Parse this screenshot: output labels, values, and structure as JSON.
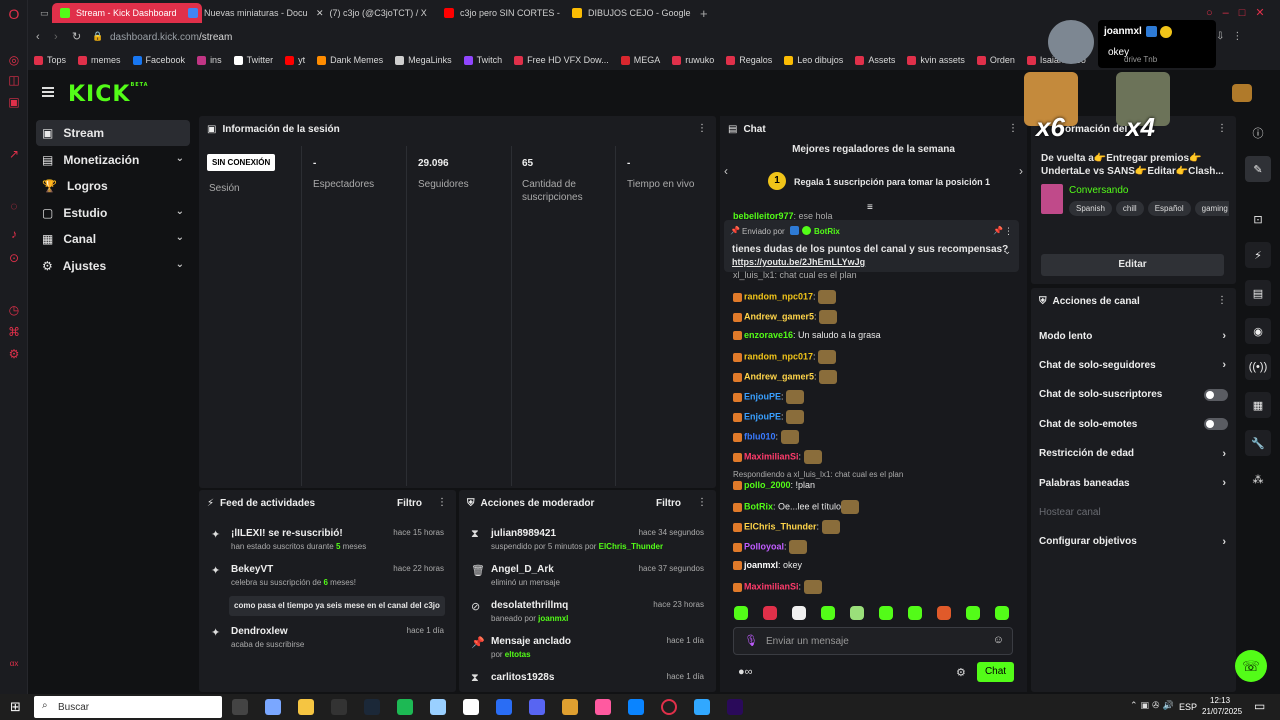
{
  "browser": {
    "tabs": [
      {
        "label": "Stream - Kick Dashboard",
        "color": "#53fc18",
        "active": true
      },
      {
        "label": "Nuevas miniaturas - Docu",
        "color": "#4285f4"
      },
      {
        "label": "(7) c3jo (@C3joTCT) / X",
        "color": "#ffffff"
      },
      {
        "label": "c3jo pero SIN CORTES -",
        "color": "#ff0000"
      },
      {
        "label": "DIBUJOS CEJO - Google D",
        "color": "#fbbc04"
      }
    ],
    "url": {
      "domain": "dashboard.kick.com",
      "path": "/stream"
    },
    "bookmarks": [
      {
        "label": "Tops",
        "color": "#e0304a"
      },
      {
        "label": "memes",
        "color": "#e0304a"
      },
      {
        "label": "Facebook",
        "color": "#1877f2"
      },
      {
        "label": "ins",
        "color": "#c13584"
      },
      {
        "label": "Twitter",
        "color": "#ffffff"
      },
      {
        "label": "yt",
        "color": "#ff0000"
      },
      {
        "label": "Dank Memes",
        "color": "#ff8c00"
      },
      {
        "label": "MegaLinks",
        "color": "#cfcfcf"
      },
      {
        "label": "Twitch",
        "color": "#9146ff"
      },
      {
        "label": "Free HD VFX Dow...",
        "color": "#e0304a"
      },
      {
        "label": "MEGA",
        "color": "#d9272e"
      },
      {
        "label": "ruwuko",
        "color": "#e0304a"
      },
      {
        "label": "Regalos",
        "color": "#e0304a"
      },
      {
        "label": "Leo dibujos",
        "color": "#fbbc04"
      },
      {
        "label": "Assets",
        "color": "#e0304a"
      },
      {
        "label": "kvin assets",
        "color": "#e0304a"
      },
      {
        "label": "Orden",
        "color": "#e0304a"
      },
      {
        "label": "Isaiah Creo",
        "color": "#e0304a"
      }
    ]
  },
  "overlay": {
    "user": "joanmxl",
    "message": "okey",
    "x6": "x6",
    "x4": "x4",
    "chip_text": "drive Tnb"
  },
  "kick": {
    "logo": "KICK",
    "logo_sup": "BETA"
  },
  "nav": [
    {
      "label": "Stream",
      "icon": "▣",
      "selected": true
    },
    {
      "label": "Monetización",
      "icon": "▤",
      "chevron": "⌄"
    },
    {
      "label": "Logros",
      "icon": "🏆"
    },
    {
      "label": "Estudio",
      "icon": "▢",
      "chevron": "⌄"
    },
    {
      "label": "Canal",
      "icon": "▦",
      "chevron": "⌄"
    },
    {
      "label": "Ajustes",
      "icon": "⚙",
      "chevron": "⌄"
    }
  ],
  "session": {
    "title": "Información de la sesión",
    "badge": "SIN CONEXIÓN",
    "stats": [
      {
        "value": "",
        "label": "Sesión"
      },
      {
        "value": "-",
        "label": "Espectadores"
      },
      {
        "value": "29.096",
        "label": "Seguidores"
      },
      {
        "value": "65",
        "label": "Cantidad de suscripciones"
      },
      {
        "value": "-",
        "label": "Tiempo en vivo"
      }
    ]
  },
  "feed": {
    "title": "Feed de actividades",
    "filter": "Filtro",
    "items": [
      {
        "title": "¡lILEXI! se re-suscribió!",
        "sub_pre": "han estado suscritos durante ",
        "sub_num": "5",
        "sub_post": " meses",
        "time": "hace 15 horas",
        "icon": "✦"
      },
      {
        "title": "BekeyVT",
        "sub_pre": "celebra su suscripción de ",
        "sub_num": "6",
        "sub_post": " meses!",
        "time": "hace 22 horas",
        "icon": "✦",
        "quote": "como pasa el tiempo ya seis mese en el canal del c3jo"
      },
      {
        "title": "Dendroxlew",
        "sub_pre": "acaba de suscribirse",
        "sub_num": "",
        "sub_post": "",
        "time": "hace 1 día",
        "icon": "✦"
      }
    ]
  },
  "mod": {
    "title": "Acciones de moderador",
    "filter": "Filtro",
    "items": [
      {
        "title": "julian8989421",
        "sub": "suspendido por 5 minutos por ",
        "by": "ElChris_Thunder",
        "time": "hace 34 segundos",
        "icon": "⧗"
      },
      {
        "title": "Angel_D_Ark",
        "sub": "eliminó un mensaje",
        "by": "",
        "time": "hace 37 segundos",
        "icon": "🗑"
      },
      {
        "title": "desolatethrillmq",
        "sub": "baneado por ",
        "by": "joanmxl",
        "time": "hace 23 horas",
        "icon": "⊘"
      },
      {
        "title": "Mensaje anclado",
        "sub": "por ",
        "by": "eltotas",
        "time": "hace 1 día",
        "icon": "📌"
      },
      {
        "title": "carlitos1928s",
        "sub": "",
        "by": "",
        "time": "hace 1 día",
        "icon": "⧗"
      }
    ]
  },
  "chat": {
    "title": "Chat",
    "gifters_title": "Mejores regaladores de la semana",
    "gift_rank": "1",
    "gift_cta": "Regala 1 suscripción para tomar la posición 1",
    "pinned_by_label": "Enviado por",
    "pinned_by": "BotRix",
    "pinned_text": "tienes dudas de los puntos del canal y sus recompensas?",
    "pinned_link": "https://youtu.be/2JhEmLLYwJg",
    "top_user": "bebelleitor977",
    "top_msg": ": ese hola",
    "above_msg": "xl_luis_lx1: chat cual es el plan",
    "messages": [
      {
        "user": "random_npc017",
        "color": "#f0c419",
        "text": "",
        "emote": true
      },
      {
        "user": "Andrew_gamer5",
        "color": "#ffd54a",
        "text": "",
        "emote": true
      },
      {
        "user": "enzorave16",
        "color": "#53fc18",
        "text": ": Un saludo a la grasa",
        "emote": false
      },
      {
        "user": "random_npc017",
        "color": "#f0c419",
        "text": "",
        "emote": true
      },
      {
        "user": "Andrew_gamer5",
        "color": "#ffd54a",
        "text": "",
        "emote": true
      },
      {
        "user": "EnjouPE",
        "color": "#3aa0ff",
        "text": "",
        "emote": true
      },
      {
        "user": "EnjouPE",
        "color": "#3aa0ff",
        "text": "",
        "emote": true
      },
      {
        "user": "fblu010",
        "color": "#3a7bff",
        "text": "",
        "emote": true
      },
      {
        "user": "MaximilianSi",
        "color": "#ff3b6b",
        "text": "",
        "emote": true
      }
    ],
    "reply_to": "Respondiendo a xl_luis_lx1: chat cual es el plan",
    "messages2": [
      {
        "user": "pollo_2000",
        "color": "#53fc18",
        "text": ": !plan",
        "emote": false
      },
      {
        "user": "BotRix",
        "color": "#53fc18",
        "text": ": Oe...lee el título",
        "emote": true
      },
      {
        "user": "ElChris_Thunder",
        "color": "#ffd54a",
        "text": "",
        "emote": true
      },
      {
        "user": "Polloyoal",
        "color": "#c05cff",
        "text": "",
        "emote": true
      },
      {
        "user": "joanmxl",
        "color": "#ffffff",
        "text": ": okey",
        "emote": false
      },
      {
        "user": "MaximilianSi",
        "color": "#ff3b6b",
        "text": "",
        "emote": true
      }
    ],
    "placeholder": "Enviar un mensaje",
    "send": "Chat"
  },
  "streaminfo": {
    "title_part": "ormación del s",
    "stream_title": "De vuelta a👉Entregar premios👉UndertaLe vs SANS👉Editar👉Clash...",
    "category": "Conversando",
    "tags": [
      "Spanish",
      "chill",
      "Español",
      "gaming"
    ],
    "edit": "Editar"
  },
  "actions": {
    "title": "Acciones de canal",
    "items": [
      {
        "label": "Modo lento",
        "type": "arrow"
      },
      {
        "label": "Chat de solo-seguidores",
        "type": "arrow"
      },
      {
        "label": "Chat de solo-suscriptores",
        "type": "toggle"
      },
      {
        "label": "Chat de solo-emotes",
        "type": "toggle"
      },
      {
        "label": "Restricción de edad",
        "type": "arrow"
      },
      {
        "label": "Palabras baneadas",
        "type": "arrow"
      },
      {
        "label": "Hostear canal",
        "type": "disabled"
      },
      {
        "label": "Configurar objetivos",
        "type": "arrow"
      }
    ]
  },
  "taskbar": {
    "search": "Buscar",
    "lang": "ESP",
    "time": "12:13",
    "date": "21/07/2025"
  }
}
